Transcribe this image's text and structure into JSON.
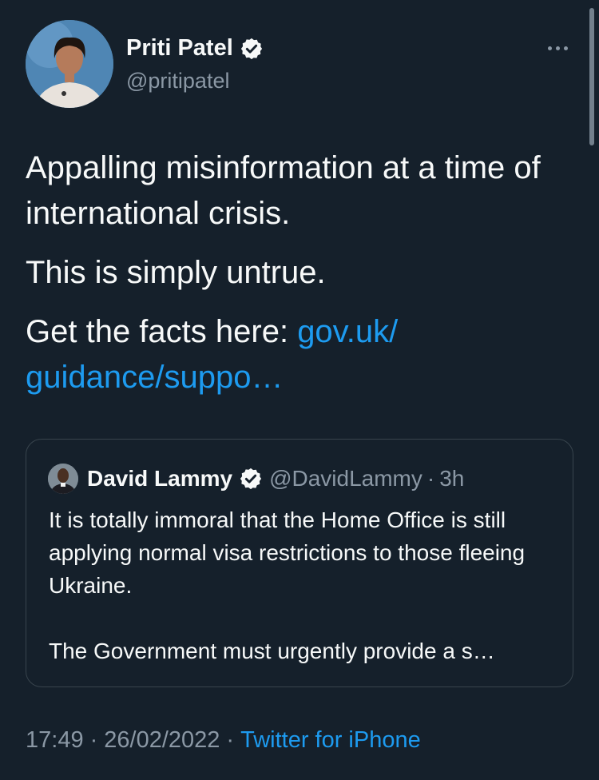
{
  "author": {
    "name": "Priti Patel",
    "handle": "@pritipatel"
  },
  "tweet": {
    "line1": "Appalling misinformation at a time of international crisis.",
    "line2": "This is simply untrue.",
    "line3_prefix": "Get the facts here:",
    "link_text": "gov.uk/ guidance/suppo…"
  },
  "quoted": {
    "name": "David Lammy",
    "handle": "@DavidLammy",
    "separator": "·",
    "time": "3h",
    "text1": "It is totally immoral that the Home Office is still applying normal visa restrictions to those fleeing Ukraine.",
    "text2": "The Government must urgently provide a s…"
  },
  "footer": {
    "time": "17:49",
    "sep1": "·",
    "date": "26/02/2022",
    "sep2": "·",
    "source": "Twitter for iPhone"
  },
  "icons": {
    "verified": "verified-badge-icon",
    "more": "more-options-icon"
  },
  "colors": {
    "background": "#15202b",
    "text": "#f7f9f9",
    "secondary": "#8b98a5",
    "link": "#1d9bf0",
    "border": "#38444d"
  }
}
